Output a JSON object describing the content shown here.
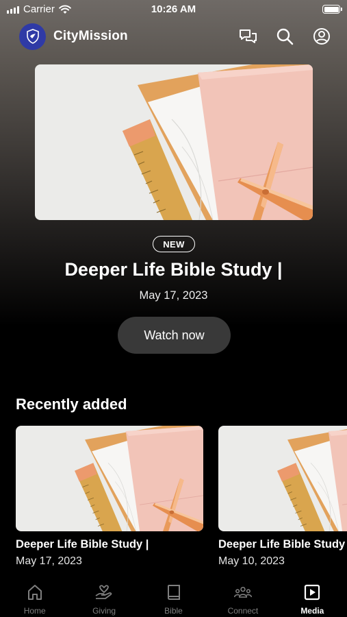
{
  "status_bar": {
    "carrier": "Carrier",
    "time": "10:26 AM"
  },
  "header": {
    "app_name": "CityMission",
    "logo_icon": "shield-dove-logo",
    "actions": [
      "chat-bubbles-icon",
      "search-icon",
      "profile-icon"
    ]
  },
  "featured": {
    "badge": "NEW",
    "title": "Deeper Life Bible Study |",
    "date": "May 17, 2023",
    "cta": "Watch now"
  },
  "recent": {
    "section_title": "Recently added",
    "items": [
      {
        "title": "Deeper Life Bible Study |",
        "date": "May 17, 2023"
      },
      {
        "title": "Deeper Life Bible Study |",
        "date": "May 10, 2023"
      }
    ]
  },
  "tabs": [
    {
      "label": "Home",
      "icon": "home-icon",
      "active": false
    },
    {
      "label": "Giving",
      "icon": "giving-hand-heart-icon",
      "active": false
    },
    {
      "label": "Bible",
      "icon": "book-icon",
      "active": false
    },
    {
      "label": "Connect",
      "icon": "people-group-icon",
      "active": false
    },
    {
      "label": "Media",
      "icon": "play-icon",
      "active": true
    }
  ],
  "colors": {
    "logo_bg": "#2f3aa6",
    "button_bg": "#393939",
    "tab_inactive": "#7f7f7f",
    "tab_active": "#ffffff"
  }
}
